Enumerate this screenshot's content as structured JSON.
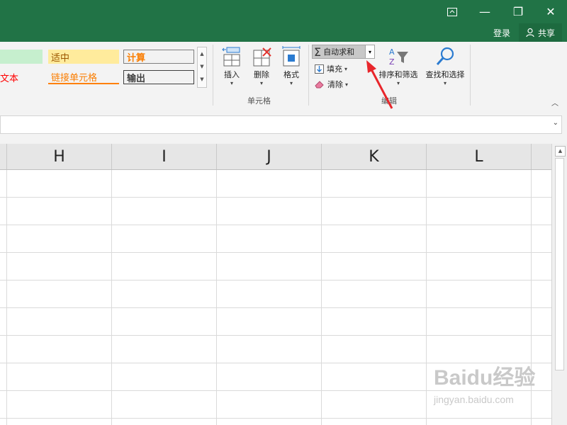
{
  "titlebar": {
    "restore_ribbon_icon": "ribbon-display-icon",
    "minimize_symbol": "—",
    "maximize_symbol": "❐",
    "close_symbol": "✕",
    "signin_label": "登录",
    "share_label": "共享"
  },
  "styles": {
    "good_partial": "",
    "neutral": "适中",
    "calculation": "计算",
    "text_partial": "文本",
    "linked_cell": "链接单元格",
    "output": "输出"
  },
  "cells_group": {
    "insert": "插入",
    "delete": "删除",
    "format": "格式",
    "label": "单元格"
  },
  "editing_group": {
    "autosum": "自动求和",
    "autosum_symbol": "Σ",
    "fill": "填充",
    "clear": "清除",
    "sort_filter": "排序和筛选",
    "find_select": "查找和选择",
    "label": "编辑"
  },
  "columns": [
    "H",
    "I",
    "J",
    "K",
    "L"
  ],
  "watermark": {
    "brand": "Baidu经验",
    "url": "jingyan.baidu.com"
  },
  "colors": {
    "title_green": "#217346",
    "good_fill": "#c6efce",
    "neutral_fill": "#ffeb9c",
    "neutral_text": "#9c5700",
    "calc_text": "#fa7d00",
    "text_red": "#ff0000",
    "arrow_red": "#e8262b"
  }
}
